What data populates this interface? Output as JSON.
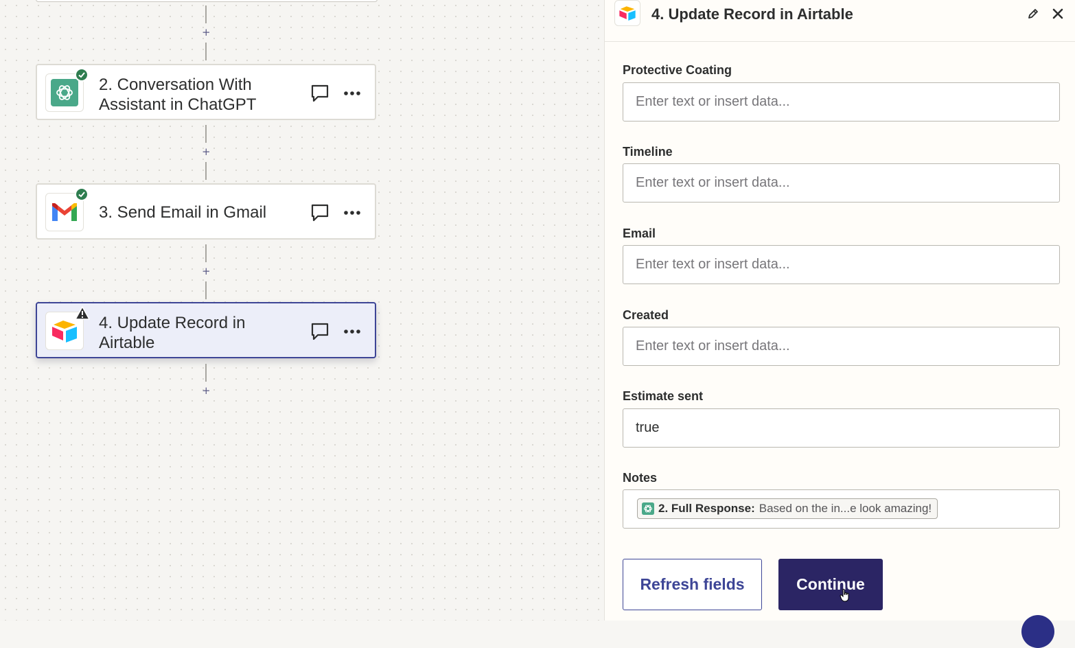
{
  "workflow": {
    "steps": [
      {
        "title_line1": "2. Conversation With",
        "title_line2": "Assistant in ChatGPT",
        "app_icon": "chatgpt-icon",
        "status": "success"
      },
      {
        "title": "3. Send Email in Gmail",
        "app_icon": "gmail-icon",
        "status": "success"
      },
      {
        "title_line1": "4. Update Record in",
        "title_line2": "Airtable",
        "app_icon": "airtable-icon",
        "status": "warning",
        "active": true
      }
    ],
    "add_step_symbol": "+"
  },
  "panel": {
    "title": "4. Update Record in Airtable",
    "fields": [
      {
        "label": "Protective Coating",
        "placeholder": "Enter text or insert data..."
      },
      {
        "label": "Timeline",
        "placeholder": "Enter text or insert data..."
      },
      {
        "label": "Email",
        "placeholder": "Enter text or insert data..."
      },
      {
        "label": "Created",
        "placeholder": "Enter text or insert data..."
      },
      {
        "label": "Estimate sent",
        "value": "true"
      },
      {
        "label": "Notes",
        "pill": {
          "key": "2. Full Response:",
          "value": "Based on the in...e look amazing!"
        }
      }
    ],
    "buttons": {
      "refresh": "Refresh fields",
      "continue": "Continue"
    }
  },
  "colors": {
    "brand_dark": "#2b2564",
    "accent": "#3d4596",
    "success": "#2e7d4f",
    "chatgpt": "#4aa889"
  }
}
